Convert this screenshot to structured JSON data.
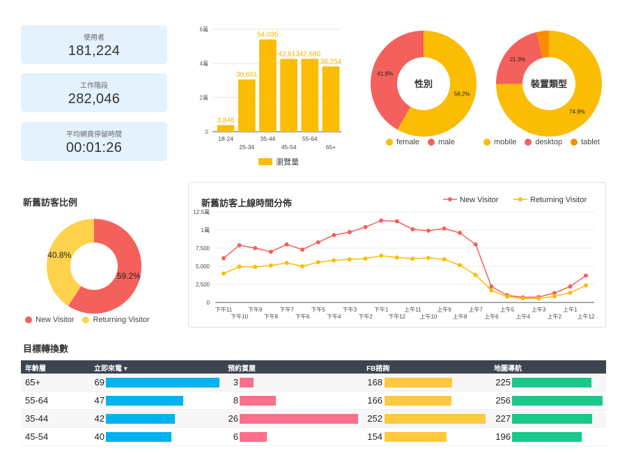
{
  "kpis": [
    {
      "label": "使用者",
      "value": "181,224"
    },
    {
      "label": "工作階段",
      "value": "282,046"
    },
    {
      "label": "平均網頁停留時間",
      "value": "00:01:26"
    }
  ],
  "age_chart": {
    "y_ticks": [
      "0",
      "2萬",
      "4萬",
      "6萬"
    ],
    "legend": "瀏覽量",
    "color": "#fbbc04"
  },
  "gender_chart": {
    "center_label": "性別",
    "legend": [
      "female",
      "male"
    ]
  },
  "device_chart": {
    "center_label": "裝置類型",
    "legend": [
      "mobile",
      "desktop",
      "tablet"
    ]
  },
  "visitor_section": {
    "title": "新舊訪客比例",
    "legend": [
      "New Visitor",
      "Returning Visitor"
    ]
  },
  "time_section": {
    "title": "新舊訪客上線時間分佈",
    "y_ticks": [
      "0",
      "2,500",
      "5,000",
      "7,500",
      "1萬",
      "12.5萬"
    ]
  },
  "conversion": {
    "title": "目標轉換數",
    "headers": [
      "年齡層",
      "立即來電 ▾",
      "預約賞屋",
      "FB諮詢",
      "地圖導航"
    ],
    "rows": [
      {
        "age": "65+",
        "call": 69,
        "booking": 3,
        "fb": 168,
        "map": 225
      },
      {
        "age": "55-64",
        "call": 47,
        "booking": 8,
        "fb": 166,
        "map": 256
      },
      {
        "age": "35-44",
        "call": 42,
        "booking": 26,
        "fb": 252,
        "map": 227
      },
      {
        "age": "45-54",
        "call": 40,
        "booking": 6,
        "fb": 154,
        "map": 196
      }
    ],
    "colors": {
      "call": "#00b2ee",
      "booking": "#ff6e8a",
      "fb": "#ffc83d",
      "map": "#18c98a"
    }
  },
  "chart_data": [
    {
      "type": "bar",
      "categories": [
        "18-24",
        "25-34",
        "35-44",
        "45-54",
        "55-64",
        "65+"
      ],
      "values": [
        3846,
        30601,
        54035,
        42613,
        42680,
        38254
      ],
      "labels": [
        "3,846",
        "30,601",
        "54,035",
        "42,613",
        "42,680",
        "38,254"
      ],
      "ylim": [
        0,
        60000
      ],
      "series_name": "瀏覽量"
    },
    {
      "type": "pie",
      "title": "性別",
      "slices": [
        {
          "name": "female",
          "value": 58.2,
          "label": "58.2%",
          "color": "#fbbc04"
        },
        {
          "name": "male",
          "value": 41.8,
          "label": "41.8%",
          "color": "#f4605b"
        }
      ]
    },
    {
      "type": "pie",
      "title": "裝置類型",
      "slices": [
        {
          "name": "mobile",
          "value": 74.9,
          "label": "74.9%",
          "color": "#fbbc04"
        },
        {
          "name": "desktop",
          "value": 21.3,
          "label": "21.3%",
          "color": "#f4605b"
        },
        {
          "name": "tablet",
          "value": 3.8,
          "label": "",
          "color": "#fb8c00"
        }
      ]
    },
    {
      "type": "pie",
      "title": "新舊訪客比例",
      "slices": [
        {
          "name": "New Visitor",
          "value": 59.2,
          "label": "59.2%",
          "color": "#f4605b"
        },
        {
          "name": "Returning Visitor",
          "value": 40.8,
          "label": "40.8%",
          "color": "#ffd24d"
        }
      ]
    },
    {
      "type": "line",
      "title": "新舊訪客上線時間分佈",
      "x": [
        "下午11",
        "下午10",
        "下午9",
        "下午8",
        "下午7",
        "下午6",
        "下午5",
        "下午4",
        "下午3",
        "下午2",
        "下午1",
        "下午12",
        "上午11",
        "上午10",
        "上午9",
        "上午8",
        "上午7",
        "上午6",
        "上午5",
        "上午4",
        "上午3",
        "上午2",
        "上午1",
        "上午12"
      ],
      "ylim": [
        0,
        12500
      ],
      "series": [
        {
          "name": "New Visitor",
          "color": "#f4605b",
          "values": [
            6100,
            7900,
            7500,
            7000,
            8000,
            7300,
            8300,
            9300,
            9700,
            10400,
            11300,
            11200,
            10100,
            9900,
            10200,
            9600,
            8000,
            2200,
            1000,
            700,
            750,
            1300,
            2200,
            3700
          ]
        },
        {
          "name": "Returning Visitor",
          "color": "#fbbc04",
          "values": [
            4000,
            4950,
            4900,
            5100,
            5450,
            5000,
            5550,
            5800,
            5950,
            6050,
            6450,
            6200,
            6050,
            6150,
            5950,
            5150,
            3800,
            1650,
            800,
            550,
            550,
            850,
            1350,
            2350
          ]
        }
      ]
    }
  ]
}
